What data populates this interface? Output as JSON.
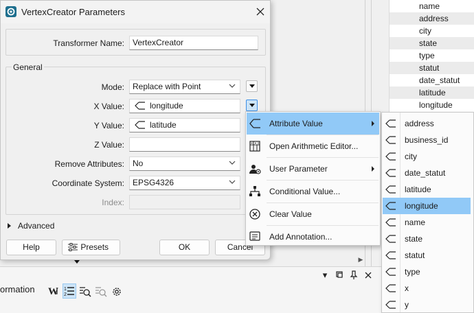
{
  "dialog": {
    "title": "VertexCreator Parameters",
    "transformer_name_label": "Transformer Name:",
    "transformer_name_value": "VertexCreator",
    "general_label": "General",
    "fields": {
      "mode": {
        "label": "Mode:",
        "value": "Replace with Point"
      },
      "x_value": {
        "label": "X Value:",
        "value": "longitude"
      },
      "y_value": {
        "label": "Y Value:",
        "value": "latitude"
      },
      "z_value": {
        "label": "Z Value:",
        "value": ""
      },
      "remove_attributes": {
        "label": "Remove Attributes:",
        "value": "No"
      },
      "coordinate_system": {
        "label": "Coordinate System:",
        "value": "EPSG4326"
      },
      "index": {
        "label": "Index:",
        "value": ""
      }
    },
    "advanced_label": "Advanced",
    "buttons": {
      "help": "Help",
      "presets": "Presets",
      "ok": "OK",
      "cancel": "Cancel"
    }
  },
  "context_menu": {
    "items": [
      {
        "label": "Attribute Value",
        "icon": "attribute-icon",
        "submenu": true,
        "highlighted": true
      },
      {
        "label": "Open Arithmetic Editor...",
        "icon": "calculator-icon",
        "submenu": false
      },
      {
        "label": "User Parameter",
        "icon": "user-parameter-icon",
        "submenu": true
      },
      {
        "label": "Conditional Value...",
        "icon": "hierarchy-icon",
        "submenu": false
      },
      {
        "label": "Clear Value",
        "icon": "clear-icon",
        "submenu": false
      },
      {
        "label": "Add Annotation...",
        "icon": "annotation-icon",
        "submenu": false
      }
    ]
  },
  "attribute_submenu": {
    "items": [
      "address",
      "business_id",
      "city",
      "date_statut",
      "latitude",
      "longitude",
      "name",
      "state",
      "statut",
      "type",
      "x",
      "y"
    ],
    "highlighted": "longitude"
  },
  "background": {
    "attribute_table": [
      "name",
      "address",
      "city",
      "state",
      "type",
      "statut",
      "date_statut",
      "latitude",
      "longitude"
    ],
    "bottom_pane_title": "ormation"
  },
  "colors": {
    "highlight": "#91c9f7",
    "active_button": "#cce4f7",
    "accent": "#3a8ee6"
  }
}
